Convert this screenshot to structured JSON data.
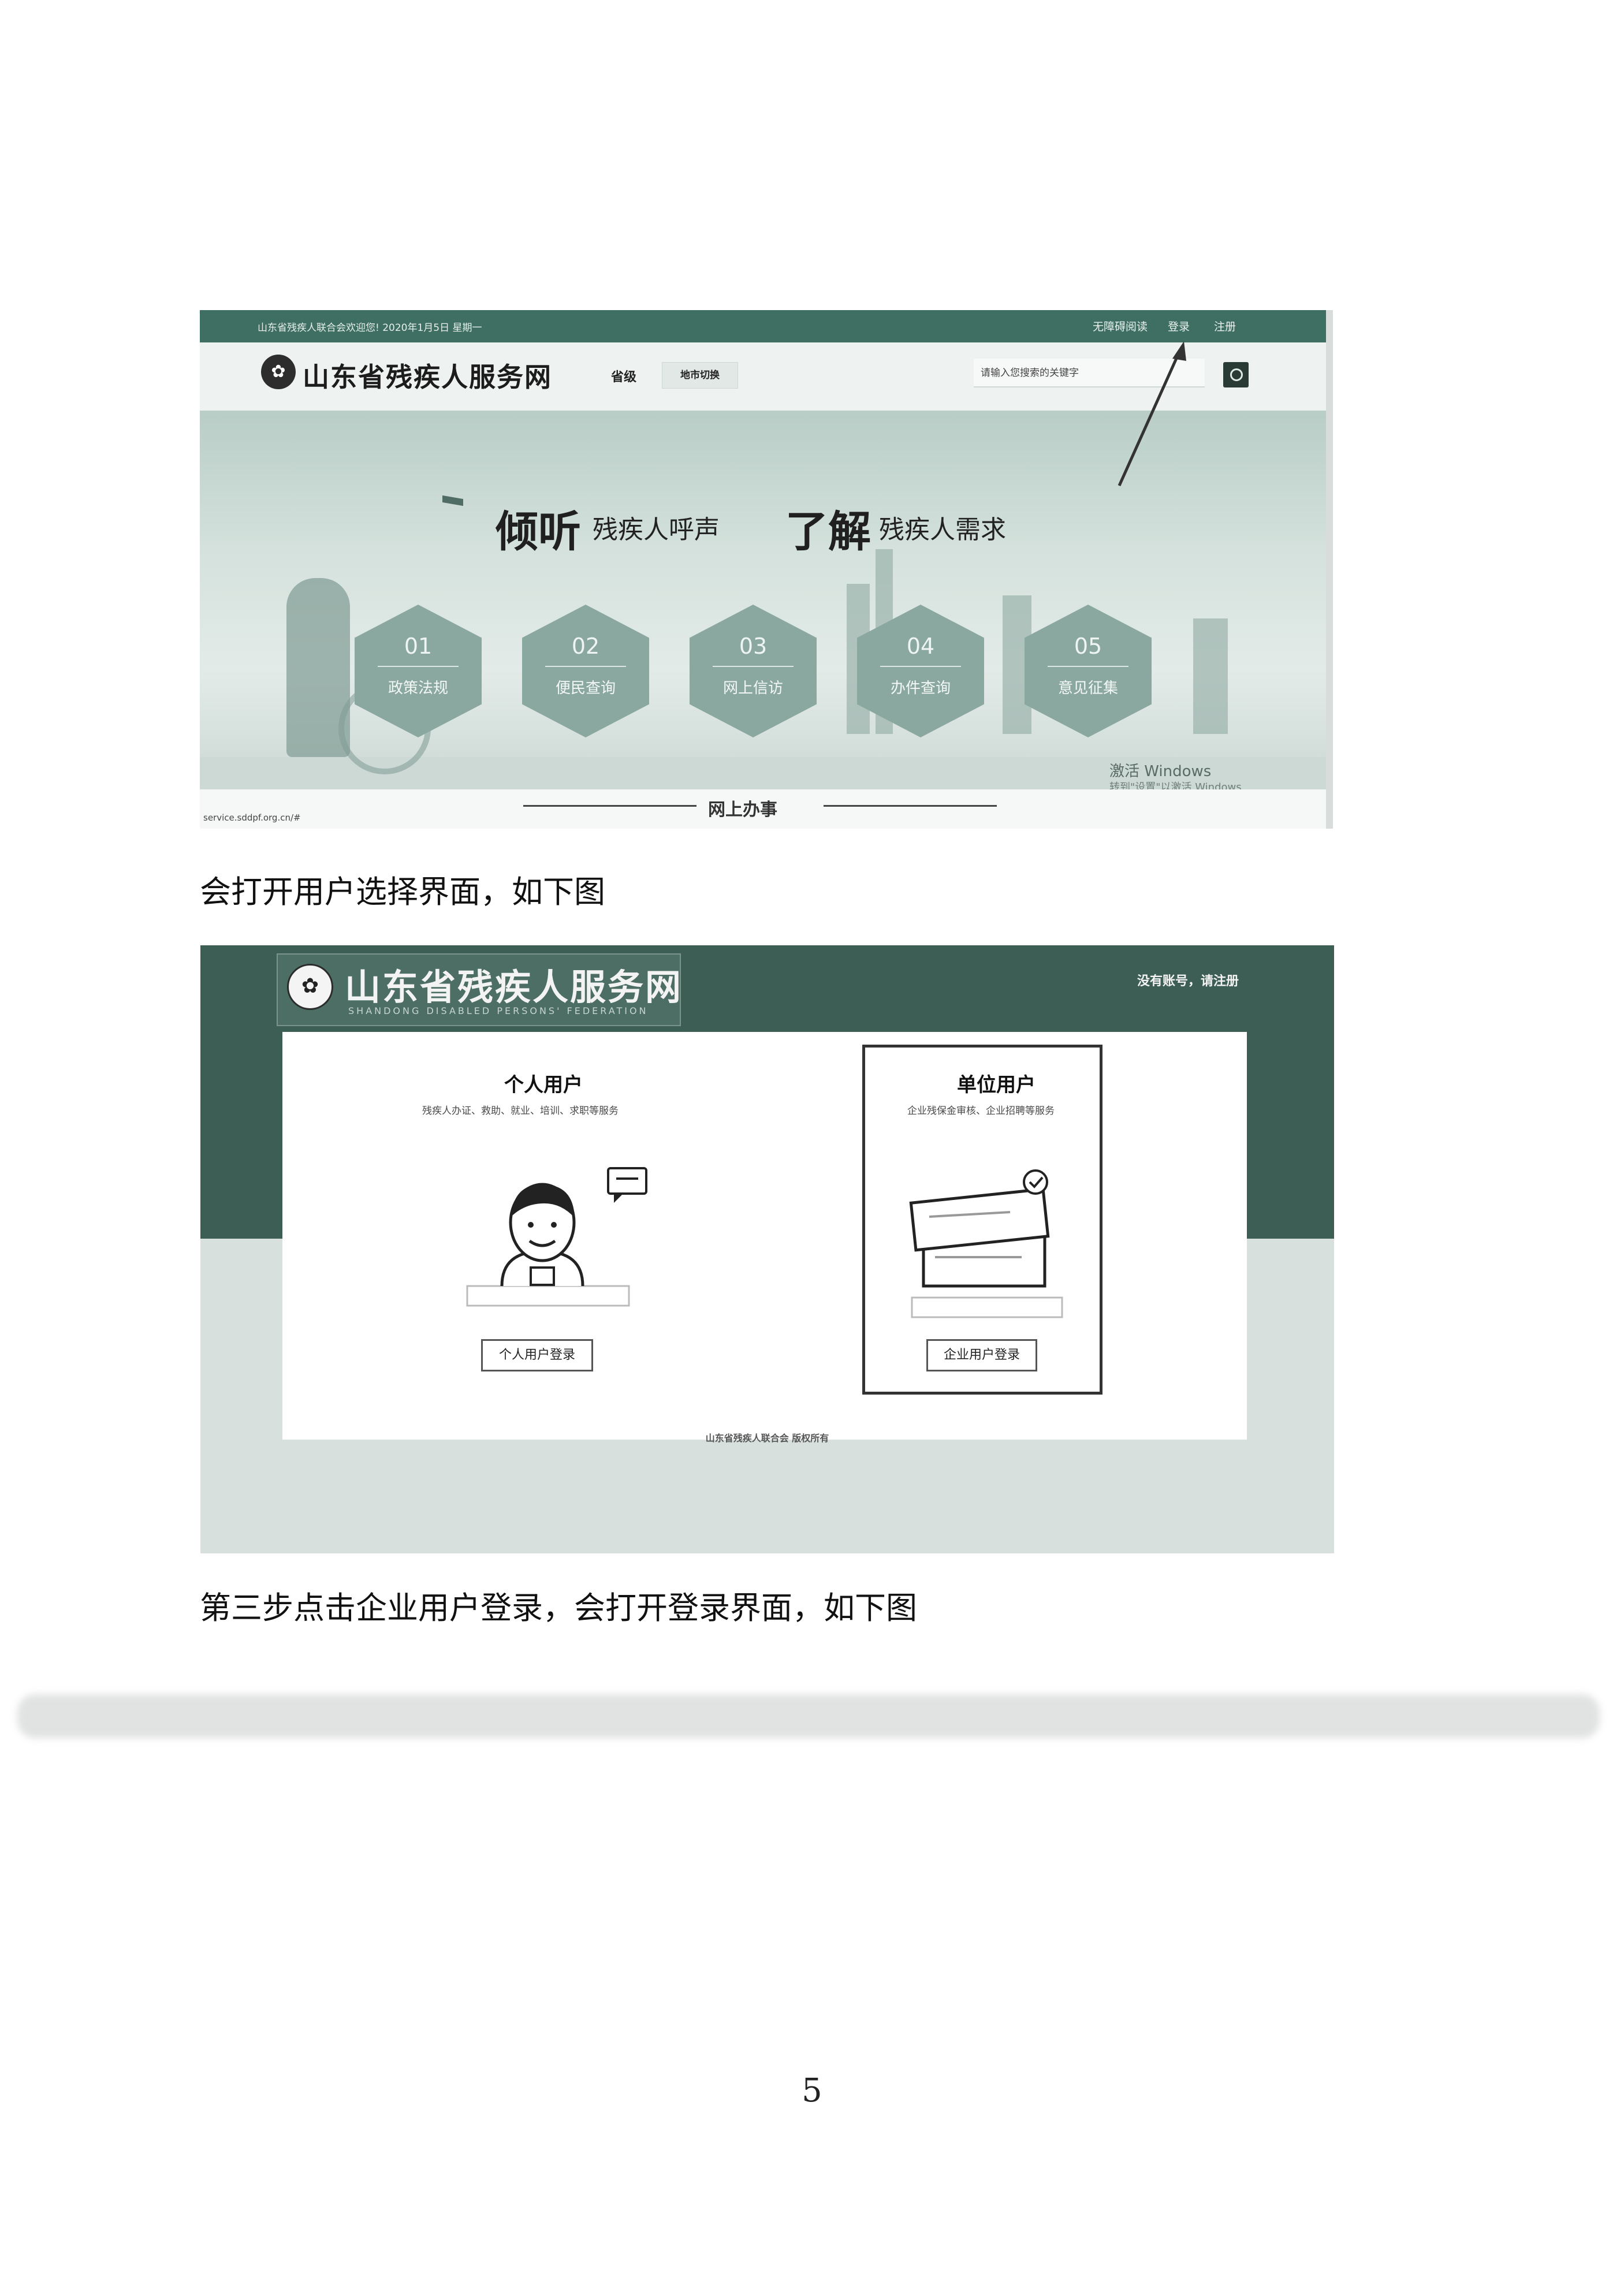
{
  "screenshot1": {
    "topbar": {
      "date_text": "山东省残疾人联合会欢迎您! 2020年1月5日 星期一",
      "barrier_free": "无障碍阅读",
      "login": "登录",
      "register": "注册"
    },
    "header": {
      "site_name": "山东省残疾人服务网",
      "province": "省级",
      "switch_label": "地市切换",
      "search_placeholder": "请输入您搜索的关键字"
    },
    "banner": {
      "slogan1_big": "倾听",
      "slogan1_small": "残疾人呼声",
      "slogan2_big": "了解",
      "slogan2_small": "残疾人需求",
      "tiles": [
        {
          "num": "01",
          "label": "政策法规"
        },
        {
          "num": "02",
          "label": "便民查询"
        },
        {
          "num": "03",
          "label": "网上信访"
        },
        {
          "num": "04",
          "label": "办件查询"
        },
        {
          "num": "05",
          "label": "意见征集"
        }
      ]
    },
    "windows_activation": {
      "line1": "激活 Windows",
      "line2": "转到\"设置\"以激活 Windows"
    },
    "footer": {
      "url": "service.sddpf.org.cn/#",
      "section": "网上办事"
    }
  },
  "caption1": "会打开用户选择界面，如下图",
  "screenshot2": {
    "site_name": "山东省残疾人服务网",
    "site_subtitle": "SHANDONG DISABLED PERSONS' FEDERATION",
    "register_link": "没有账号，请注册",
    "personal": {
      "title": "个人用户",
      "subtitle": "残疾人办证、救助、就业、培训、求职等服务",
      "button": "个人用户登录"
    },
    "unit": {
      "title": "单位用户",
      "subtitle": "企业残保金审核、企业招聘等服务",
      "button": "企业用户登录"
    },
    "copyright": "山东省残疾人联合会 版权所有"
  },
  "caption2": "第三步点击企业用户登录，会打开登录界面，如下图",
  "page_number": "5",
  "colors": {
    "header_green": "#3f6f63",
    "dark_green": "#3d5e55",
    "banner_tint": "#b9cdc7",
    "hex_tile": "#8aa8a0"
  },
  "icons": [
    "emblem-icon",
    "search-icon",
    "arrow-annotation",
    "avatar-illustration",
    "chat-bubble-icon",
    "documents-illustration",
    "check-badge-icon"
  ]
}
